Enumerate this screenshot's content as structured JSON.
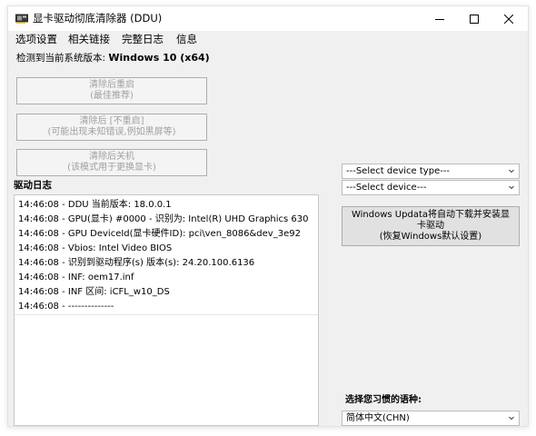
{
  "window": {
    "title": "显卡驱动彻底清除器 (DDU)"
  },
  "menu": [
    {
      "label": "选项设置"
    },
    {
      "label": "相关链接"
    },
    {
      "label": "完整日志"
    },
    {
      "label": "信息"
    }
  ],
  "detect": {
    "prefix": "检测到当前系统版本: ",
    "os": "Windows 10 (x64)"
  },
  "actions": [
    {
      "line1": "清除后重启",
      "line2": "(最佳推荐)"
    },
    {
      "line1": "清除后 [不重启]",
      "line2": "(可能出现未知错误,例如黑屏等)"
    },
    {
      "line1": "清除后关机",
      "line2": "(该模式用于更换显卡)"
    }
  ],
  "log": {
    "label": "驱动日志",
    "lines": [
      "14:46:08 - DDU 当前版本: 18.0.0.1",
      "14:46:08 - GPU(显卡) #0000 - 识别为: Intel(R) UHD Graphics 630",
      "14:46:08 - GPU DeviceId(显卡硬件ID): pci\\ven_8086&dev_3e92",
      "14:46:08 - Vbios: Intel Video BIOS",
      "14:46:08 - 识别到驱动程序(s) 版本(s): 24.20.100.6136",
      "14:46:08 - INF: oem17.inf",
      "14:46:08 - INF 区间: iCFL_w10_DS",
      "14:46:08 - --------------"
    ]
  },
  "device_type_select": {
    "value": "---Select device type---"
  },
  "device_select": {
    "value": "---Select device---"
  },
  "windows_update_button": {
    "line1": "Windows Updata将自动下载并安装显",
    "line2": "卡驱动",
    "line3": "(恢复Windows默认设置)"
  },
  "language": {
    "label": "选择您习惯的语种:",
    "value": "简体中文(CHN)"
  },
  "colors": {
    "window_bg": "#f0f0f0",
    "disabled_text": "#a0a0a0",
    "button_face": "#e1e1e1"
  }
}
